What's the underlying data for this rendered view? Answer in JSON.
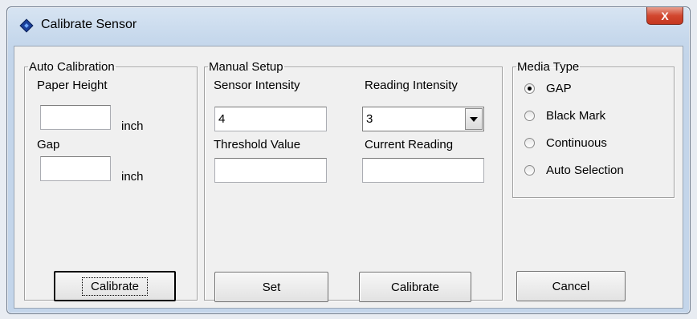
{
  "window": {
    "title": "Calibrate Sensor",
    "close_glyph": "X"
  },
  "auto_calibration": {
    "legend": "Auto Calibration",
    "paper_height_label": "Paper Height",
    "paper_height_value": "",
    "paper_height_unit": "inch",
    "gap_label": "Gap",
    "gap_value": "",
    "gap_unit": "inch",
    "calibrate_button": "Calibrate"
  },
  "manual_setup": {
    "legend": "Manual Setup",
    "sensor_intensity_label": "Sensor Intensity",
    "sensor_intensity_value": "4",
    "reading_intensity_label": "Reading Intensity",
    "reading_intensity_value": "3",
    "threshold_label": "Threshold Value",
    "threshold_value": "",
    "current_reading_label": "Current Reading",
    "current_reading_value": "",
    "set_button": "Set",
    "calibrate_button": "Calibrate"
  },
  "media_type": {
    "legend": "Media Type",
    "options": [
      {
        "label": "GAP",
        "selected": true
      },
      {
        "label": "Black Mark",
        "selected": false
      },
      {
        "label": "Continuous",
        "selected": false
      },
      {
        "label": "Auto Selection",
        "selected": false
      }
    ],
    "cancel_button": "Cancel"
  }
}
